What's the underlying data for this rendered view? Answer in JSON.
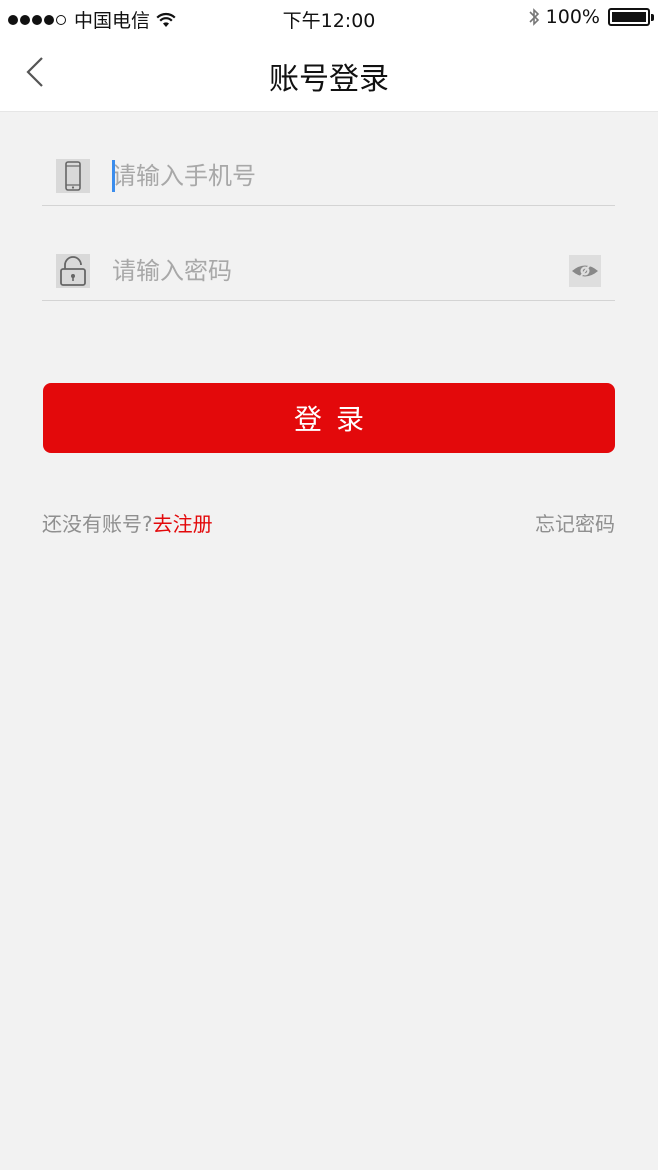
{
  "status_bar": {
    "carrier": "中国电信",
    "time": "下午12:00",
    "battery": "100%",
    "icons": [
      "signal-dots-icon",
      "wifi-icon",
      "bluetooth-icon",
      "battery-icon"
    ]
  },
  "navbar": {
    "title": "账号登录",
    "back_icon": "chevron-left-icon"
  },
  "form": {
    "phone": {
      "placeholder": "请输入手机号",
      "value": "",
      "icon": "phone-icon"
    },
    "password": {
      "placeholder": "请输入密码",
      "value": "",
      "icon": "lock-icon",
      "toggle_icon": "eye-icon"
    }
  },
  "actions": {
    "login_label": "登录",
    "no_account_text": "还没有账号?",
    "register_label": "去注册",
    "forgot_label": "忘记密码"
  },
  "colors": {
    "accent": "#e3090b",
    "background": "#f2f2f2",
    "caret": "#3b8ded"
  }
}
